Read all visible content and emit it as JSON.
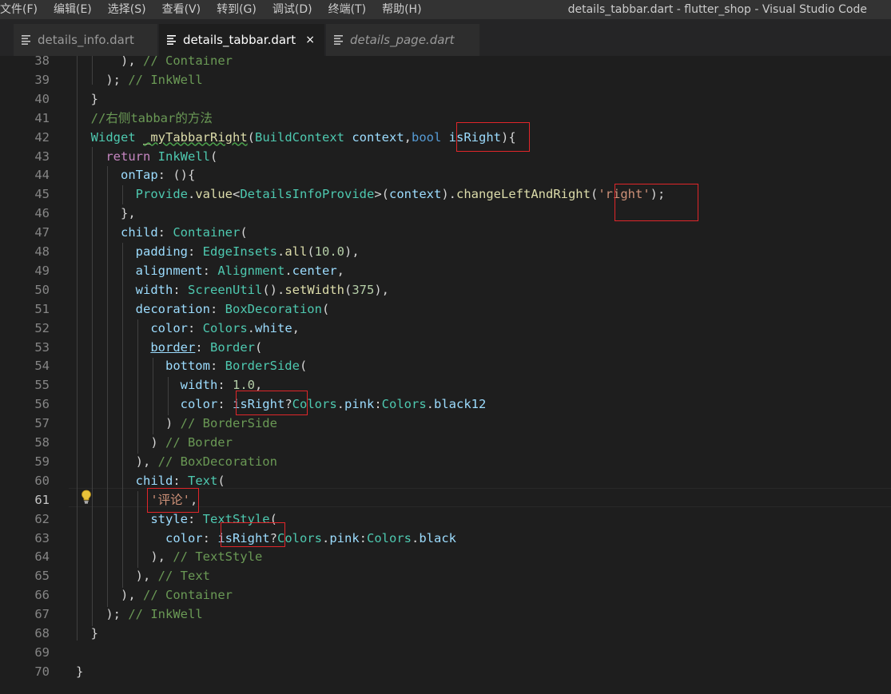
{
  "menu": [
    "文件(F)",
    "编辑(E)",
    "选择(S)",
    "查看(V)",
    "转到(G)",
    "调试(D)",
    "终端(T)",
    "帮助(H)"
  ],
  "window_title": "details_tabbar.dart - flutter_shop - Visual Studio Code",
  "tabs": [
    {
      "label": "details_info.dart",
      "state": "inactive"
    },
    {
      "label": "details_tabbar.dart",
      "state": "active"
    },
    {
      "label": "details_page.dart",
      "state": "preview"
    }
  ],
  "close_glyph": "×",
  "current_line": "61",
  "lines": [
    {
      "n": "38",
      "tokens": [
        [
          "p",
          "      ), "
        ],
        [
          "c",
          "// Container"
        ]
      ]
    },
    {
      "n": "39",
      "tokens": [
        [
          "p",
          "    ); "
        ],
        [
          "c",
          "// InkWell"
        ]
      ]
    },
    {
      "n": "40",
      "tokens": [
        [
          "p",
          "  }"
        ]
      ]
    },
    {
      "n": "41",
      "tokens": [
        [
          "c",
          "  //右侧tabbar的方法"
        ]
      ]
    },
    {
      "n": "42",
      "tokens": [
        [
          "t",
          "  Widget"
        ],
        [
          "p",
          " "
        ],
        [
          "f squig",
          "_myTabbarRight"
        ],
        [
          "p",
          "("
        ],
        [
          "t",
          "BuildContext"
        ],
        [
          "p",
          " "
        ],
        [
          "v",
          "context"
        ],
        [
          "p",
          ","
        ],
        [
          "kw",
          "bool"
        ],
        [
          "p",
          " "
        ],
        [
          "v",
          "isRight"
        ],
        [
          "p",
          "){"
        ]
      ]
    },
    {
      "n": "43",
      "tokens": [
        [
          "k",
          "    return"
        ],
        [
          "p",
          " "
        ],
        [
          "t",
          "InkWell"
        ],
        [
          "p",
          "("
        ]
      ]
    },
    {
      "n": "44",
      "tokens": [
        [
          "v",
          "      onTap"
        ],
        [
          "p",
          ": (){"
        ]
      ]
    },
    {
      "n": "45",
      "tokens": [
        [
          "t",
          "        Provide"
        ],
        [
          "p",
          "."
        ],
        [
          "f",
          "value"
        ],
        [
          "p",
          "<"
        ],
        [
          "t",
          "DetailsInfoProvide"
        ],
        [
          "p",
          ">("
        ],
        [
          "v",
          "context"
        ],
        [
          "p",
          ")."
        ],
        [
          "f",
          "changeLeftAndRight"
        ],
        [
          "p",
          "("
        ],
        [
          "s",
          "'right'"
        ],
        [
          "p",
          ");"
        ]
      ]
    },
    {
      "n": "46",
      "tokens": [
        [
          "p",
          "      },"
        ]
      ]
    },
    {
      "n": "47",
      "tokens": [
        [
          "v",
          "      child"
        ],
        [
          "p",
          ": "
        ],
        [
          "t",
          "Container"
        ],
        [
          "p",
          "("
        ]
      ]
    },
    {
      "n": "48",
      "tokens": [
        [
          "v",
          "        padding"
        ],
        [
          "p",
          ": "
        ],
        [
          "t",
          "EdgeInsets"
        ],
        [
          "p",
          "."
        ],
        [
          "f",
          "all"
        ],
        [
          "p",
          "("
        ],
        [
          "n",
          "10.0"
        ],
        [
          "p",
          "),"
        ]
      ]
    },
    {
      "n": "49",
      "tokens": [
        [
          "v",
          "        alignment"
        ],
        [
          "p",
          ": "
        ],
        [
          "t",
          "Alignment"
        ],
        [
          "p",
          "."
        ],
        [
          "v",
          "center"
        ],
        [
          "p",
          ","
        ]
      ]
    },
    {
      "n": "50",
      "tokens": [
        [
          "v",
          "        width"
        ],
        [
          "p",
          ": "
        ],
        [
          "t",
          "ScreenUtil"
        ],
        [
          "p",
          "()."
        ],
        [
          "f",
          "setWidth"
        ],
        [
          "p",
          "("
        ],
        [
          "n",
          "375"
        ],
        [
          "p",
          "),"
        ]
      ]
    },
    {
      "n": "51",
      "tokens": [
        [
          "v",
          "        decoration"
        ],
        [
          "p",
          ": "
        ],
        [
          "t",
          "BoxDecoration"
        ],
        [
          "p",
          "("
        ]
      ]
    },
    {
      "n": "52",
      "tokens": [
        [
          "v",
          "          color"
        ],
        [
          "p",
          ": "
        ],
        [
          "t",
          "Colors"
        ],
        [
          "p",
          "."
        ],
        [
          "v",
          "white"
        ],
        [
          "p",
          ","
        ]
      ]
    },
    {
      "n": "53",
      "tokens": [
        [
          "p",
          "          "
        ],
        [
          "v u",
          "border"
        ],
        [
          "p",
          ": "
        ],
        [
          "t",
          "Border"
        ],
        [
          "p",
          "("
        ]
      ]
    },
    {
      "n": "54",
      "tokens": [
        [
          "v",
          "            bottom"
        ],
        [
          "p",
          ": "
        ],
        [
          "t",
          "BorderSide"
        ],
        [
          "p",
          "("
        ]
      ]
    },
    {
      "n": "55",
      "tokens": [
        [
          "v",
          "              width"
        ],
        [
          "p",
          ": "
        ],
        [
          "n",
          "1.0"
        ],
        [
          "p",
          ","
        ]
      ]
    },
    {
      "n": "56",
      "tokens": [
        [
          "v",
          "              color"
        ],
        [
          "p",
          ": "
        ],
        [
          "v",
          "isRight"
        ],
        [
          "p",
          "?"
        ],
        [
          "t",
          "Colors"
        ],
        [
          "p",
          "."
        ],
        [
          "v",
          "pink"
        ],
        [
          "p",
          ":"
        ],
        [
          "t",
          "Colors"
        ],
        [
          "p",
          "."
        ],
        [
          "v",
          "black12"
        ]
      ]
    },
    {
      "n": "57",
      "tokens": [
        [
          "p",
          "            ) "
        ],
        [
          "c",
          "// BorderSide"
        ]
      ]
    },
    {
      "n": "58",
      "tokens": [
        [
          "p",
          "          ) "
        ],
        [
          "c",
          "// Border"
        ]
      ]
    },
    {
      "n": "59",
      "tokens": [
        [
          "p",
          "        ), "
        ],
        [
          "c",
          "// BoxDecoration"
        ]
      ]
    },
    {
      "n": "60",
      "tokens": [
        [
          "v",
          "        child"
        ],
        [
          "p",
          ": "
        ],
        [
          "t",
          "Text"
        ],
        [
          "p",
          "("
        ]
      ]
    },
    {
      "n": "61",
      "tokens": [
        [
          "s",
          "          '评论'"
        ],
        [
          "p",
          ","
        ]
      ]
    },
    {
      "n": "62",
      "tokens": [
        [
          "v",
          "          style"
        ],
        [
          "p",
          ": "
        ],
        [
          "t",
          "TextStyle"
        ],
        [
          "p",
          "("
        ]
      ]
    },
    {
      "n": "63",
      "tokens": [
        [
          "v",
          "            color"
        ],
        [
          "p",
          ": "
        ],
        [
          "v",
          "isRight"
        ],
        [
          "p",
          "?"
        ],
        [
          "t",
          "Colors"
        ],
        [
          "p",
          "."
        ],
        [
          "v",
          "pink"
        ],
        [
          "p",
          ":"
        ],
        [
          "t",
          "Colors"
        ],
        [
          "p",
          "."
        ],
        [
          "v",
          "black"
        ]
      ]
    },
    {
      "n": "64",
      "tokens": [
        [
          "p",
          "          ), "
        ],
        [
          "c",
          "// TextStyle"
        ]
      ]
    },
    {
      "n": "65",
      "tokens": [
        [
          "p",
          "        ), "
        ],
        [
          "c",
          "// Text"
        ]
      ]
    },
    {
      "n": "66",
      "tokens": [
        [
          "p",
          "      ), "
        ],
        [
          "c",
          "// Container"
        ]
      ]
    },
    {
      "n": "67",
      "tokens": [
        [
          "p",
          "    ); "
        ],
        [
          "c",
          "// InkWell"
        ]
      ]
    },
    {
      "n": "68",
      "tokens": [
        [
          "p",
          "  }"
        ]
      ]
    },
    {
      "n": "69",
      "tokens": []
    },
    {
      "n": "70",
      "tokens": [
        [
          "p",
          "}"
        ]
      ]
    }
  ],
  "colors": {
    "background": "#1e1e1e",
    "highlight_box": "#e0262a",
    "lightbulb": "#e8c23a"
  }
}
